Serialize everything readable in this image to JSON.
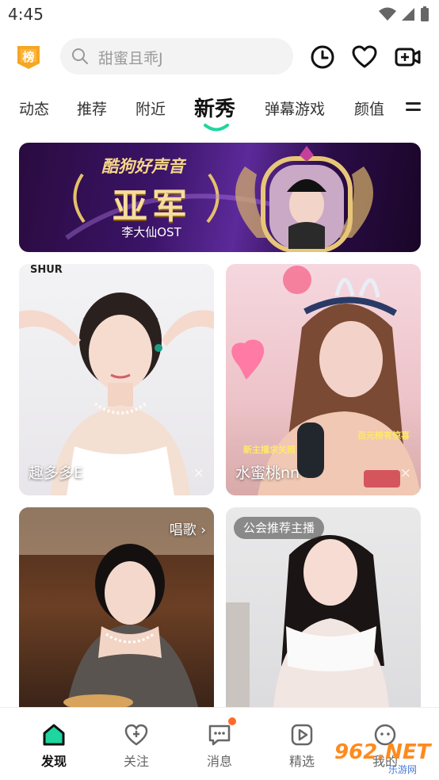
{
  "status_bar": {
    "time": "4:45"
  },
  "header": {
    "rank_badge": "榜",
    "search_placeholder": "甜蜜且乖J",
    "icons": [
      "history-icon",
      "heart-icon",
      "video-camera-icon"
    ]
  },
  "tabs": {
    "items": [
      "动态",
      "推荐",
      "附近",
      "新秀",
      "弹幕游戏",
      "颜值"
    ],
    "active": "新秀"
  },
  "banner": {
    "title": "酷狗好声音",
    "rank": "亚军",
    "subtitle": "李大仙OST"
  },
  "cards": [
    {
      "name": "趣多多E",
      "close": "×",
      "overlay": "SHUR"
    },
    {
      "name": "水蜜桃nn",
      "close": "×",
      "overlay_left": "新主播求关照",
      "overlay_right": "百元榜有惊喜"
    },
    {
      "tag": "唱歌 ›"
    },
    {
      "tag": "公会推荐主播"
    }
  ],
  "bottom_nav": {
    "items": [
      {
        "label": "发现",
        "icon": "discover-icon",
        "active": true
      },
      {
        "label": "关注",
        "icon": "follow-heart-icon",
        "active": false
      },
      {
        "label": "消息",
        "icon": "message-icon",
        "active": false,
        "badge": true
      },
      {
        "label": "精选",
        "icon": "play-icon",
        "active": false
      },
      {
        "label": "我的",
        "icon": "profile-icon",
        "active": false
      }
    ]
  },
  "watermark": {
    "text": "962.NET",
    "sub": "乐游网"
  },
  "colors": {
    "accent": "#1ed6a0",
    "badge": "#f5a623",
    "dot": "#ff6a2a"
  }
}
